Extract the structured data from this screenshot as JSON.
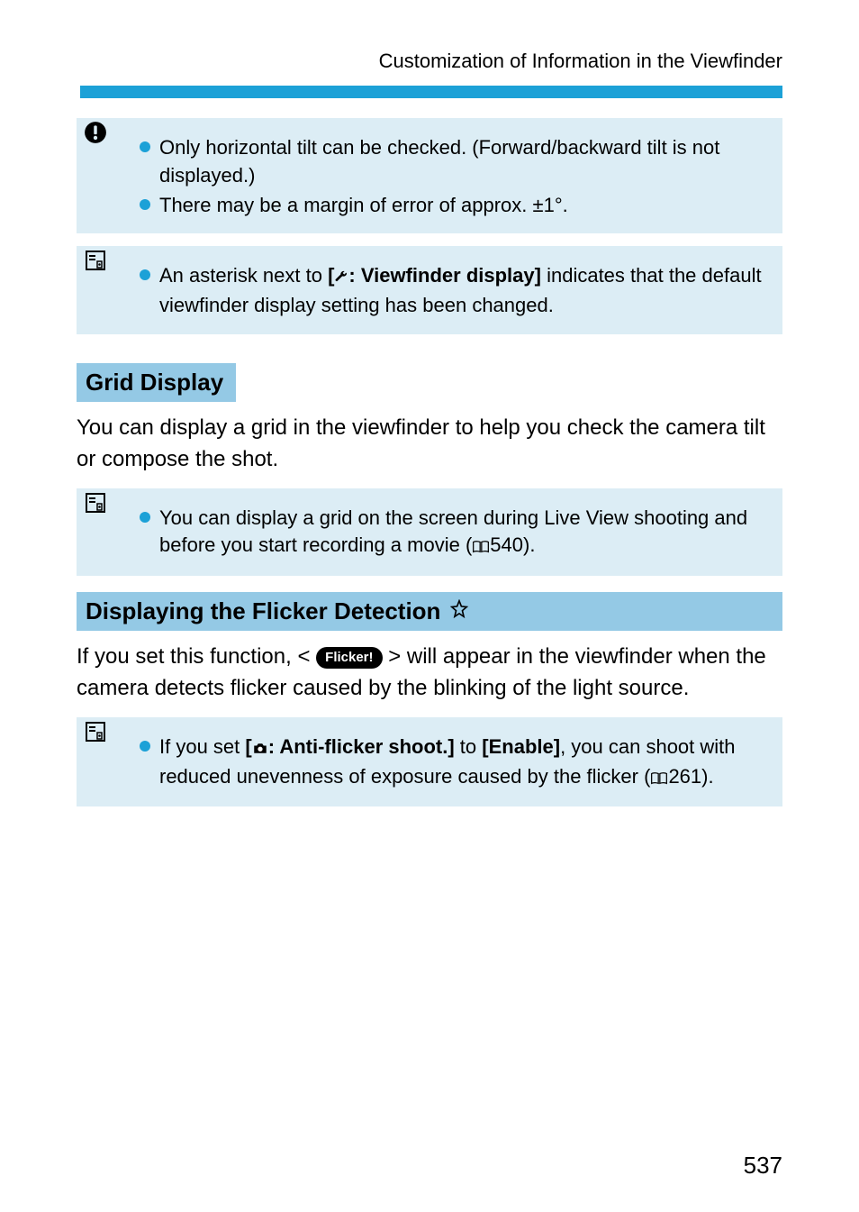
{
  "header": {
    "title": "Customization of Information in the Viewfinder"
  },
  "caution_box": {
    "bullets": [
      "Only horizontal tilt can be checked. (Forward/backward tilt is not displayed.)",
      "There may be a margin of error of approx. ±1°."
    ]
  },
  "note_box_1": {
    "bullet_prefix": "An asterisk next to ",
    "bold1_open": "[",
    "bold1_close": ": Viewfinder display]",
    "bullet_suffix": " indicates that the default viewfinder display setting has been changed."
  },
  "section_grid": {
    "heading": "Grid Display",
    "body": "You can display a grid in the viewfinder to help you check the camera tilt or compose the shot."
  },
  "note_box_2": {
    "prefix": "You can display a grid on the screen during Live View shooting and before you start recording a movie (",
    "pageref": "540",
    "suffix": ")."
  },
  "section_flicker": {
    "heading": "Displaying the Flicker Detection",
    "body_prefix": "If you set this function, <",
    "badge": "Flicker!",
    "body_suffix": "> will appear in the viewfinder when the camera detects flicker caused by the blinking of the light source."
  },
  "note_box_3": {
    "prefix": "If you set ",
    "bold_open": "[",
    "bold_close": ": Anti-flicker shoot.]",
    "mid": " to ",
    "bold2": "[Enable]",
    "suffix1": ", you can shoot with reduced unevenness of exposure caused by the flicker (",
    "pageref": "261",
    "suffix2": ")."
  },
  "page_number": "537"
}
